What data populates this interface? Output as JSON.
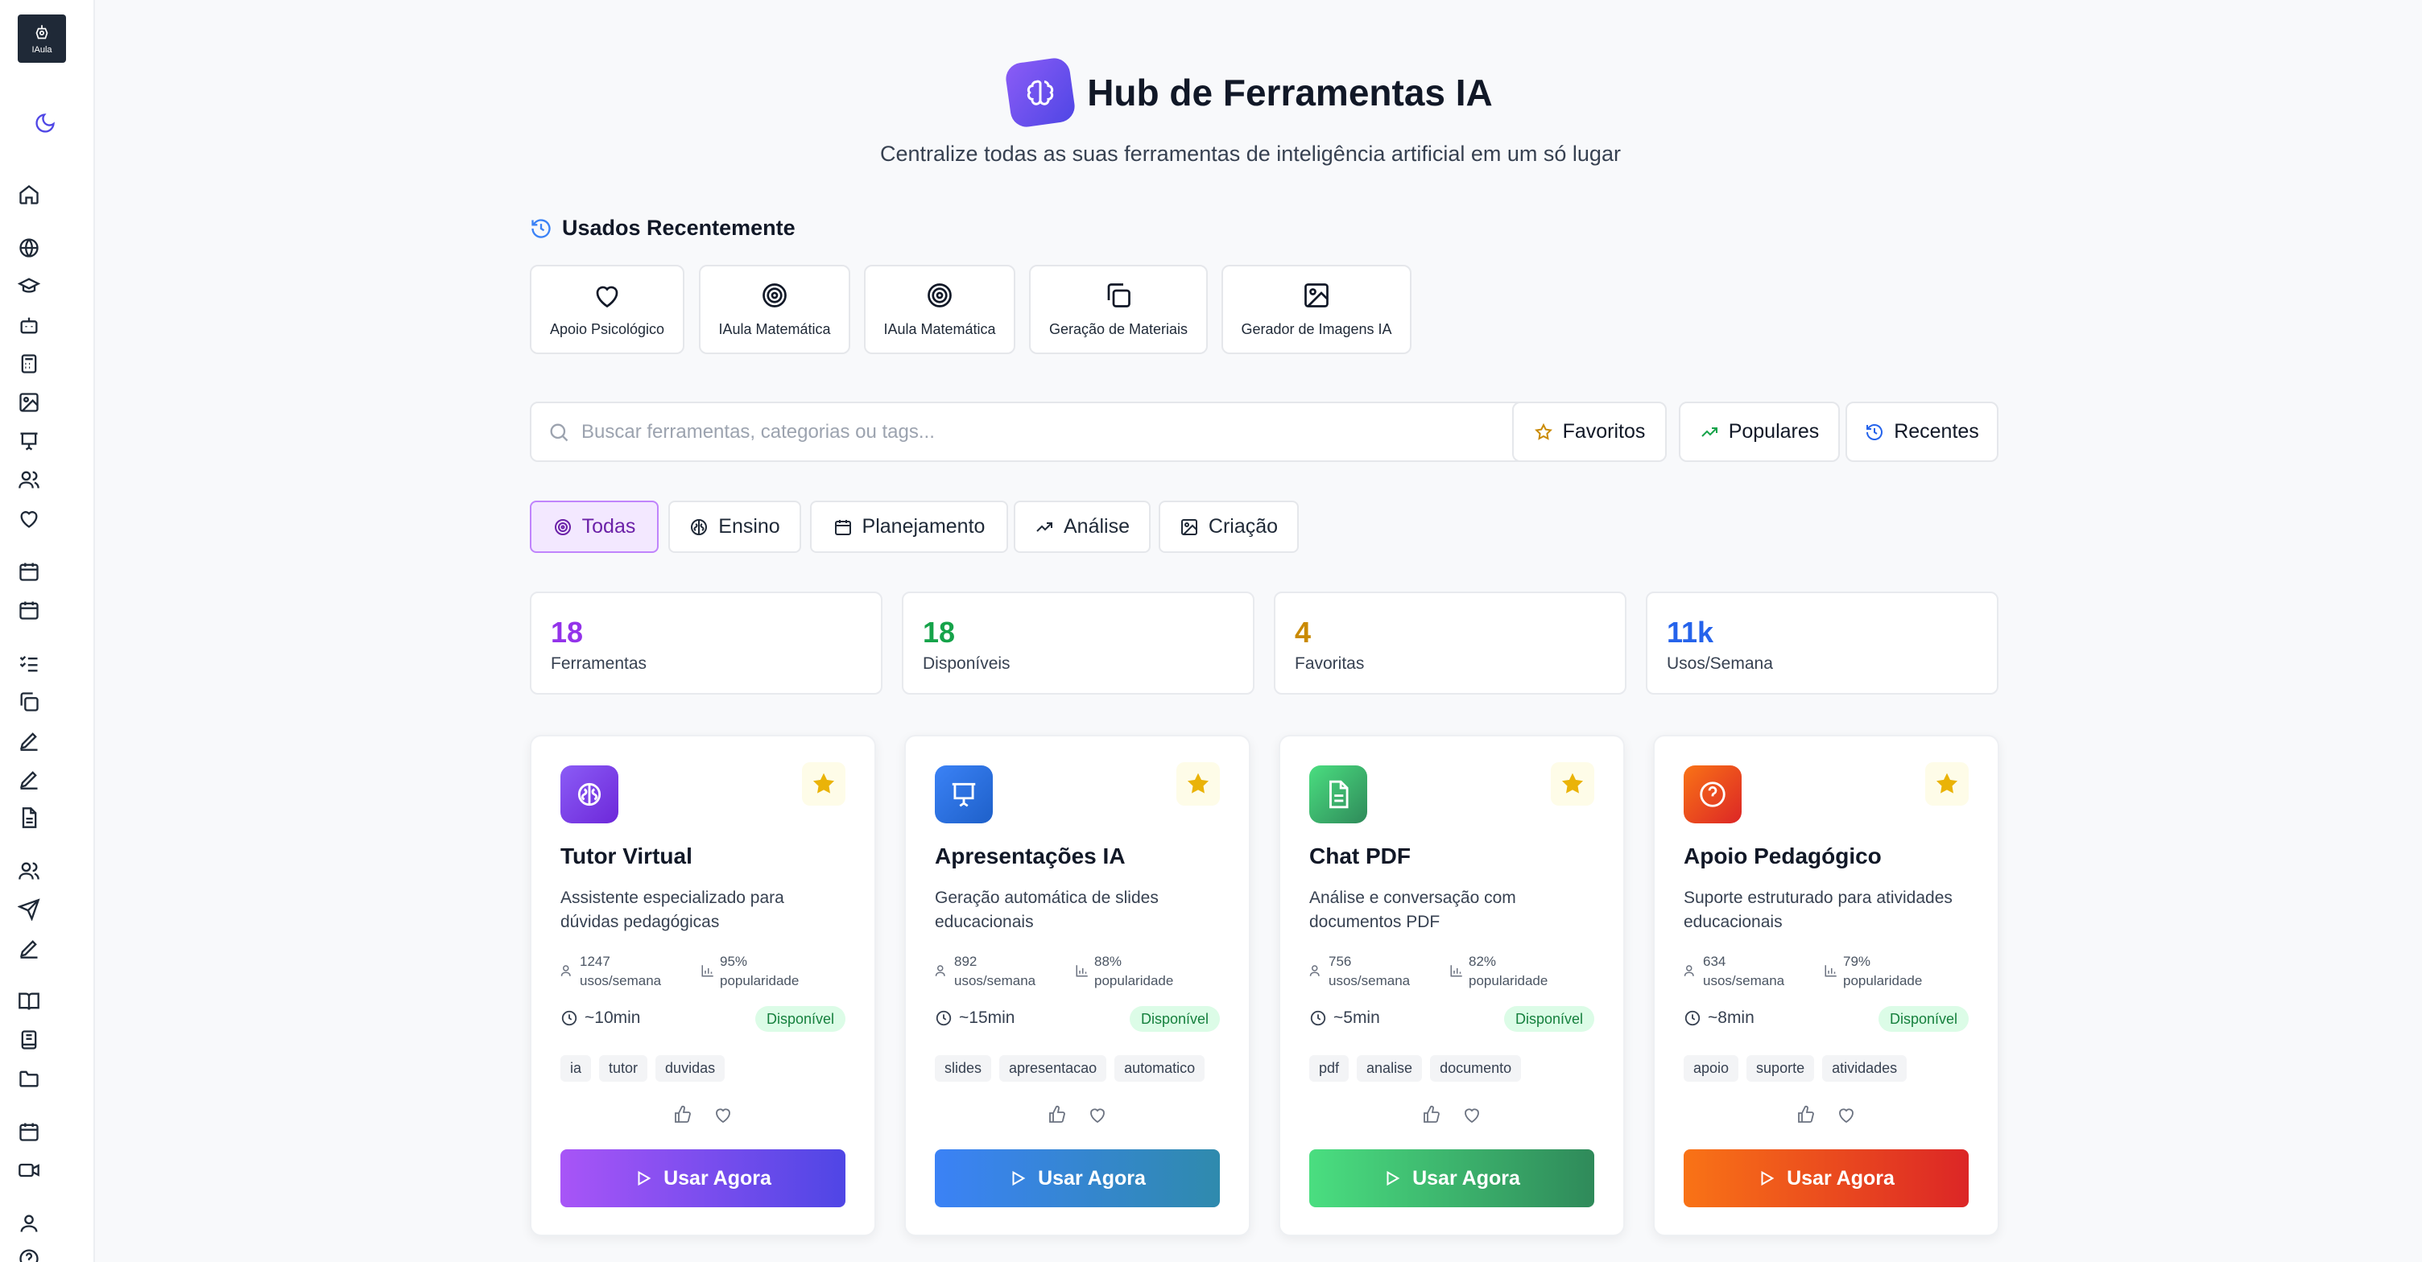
{
  "sidebar": {
    "logo_text": "IAula",
    "icons": [
      "moon-icon",
      "home-icon",
      "globe-icon",
      "graduation-cap-icon",
      "bot-icon",
      "calculator-icon",
      "image-icon",
      "presentation-icon",
      "users-icon",
      "heart-icon",
      "calendar-icon",
      "calendar-icon",
      "list-check-icon",
      "copy-icon",
      "pen-icon",
      "pen-icon",
      "file-text-icon",
      "users-icon",
      "send-icon",
      "pen-icon",
      "book-open-icon",
      "notebook-icon",
      "folder-icon",
      "calendar-icon",
      "video-icon",
      "user-icon",
      "help-icon"
    ]
  },
  "header": {
    "title": "Hub de Ferramentas IA",
    "subtitle": "Centralize todas as suas ferramentas de inteligência artificial em um só lugar"
  },
  "recent": {
    "title": "Usados Recentemente",
    "items": [
      {
        "label": "Apoio Psicológico",
        "icon": "heart-icon"
      },
      {
        "label": "IAula Matemática",
        "icon": "target-icon"
      },
      {
        "label": "IAula Matemática",
        "icon": "target-icon"
      },
      {
        "label": "Geração de Materiais",
        "icon": "copy-icon"
      },
      {
        "label": "Gerador de Imagens IA",
        "icon": "image-icon"
      }
    ]
  },
  "search": {
    "placeholder": "Buscar ferramentas, categorias ou tags...",
    "value": ""
  },
  "filters": {
    "favorites": "Favoritos",
    "popular": "Populares",
    "recent": "Recentes"
  },
  "categories": [
    "Todas",
    "Ensino",
    "Planejamento",
    "Análise",
    "Criação"
  ],
  "active_category": "Todas",
  "stats": [
    {
      "value": "18",
      "label": "Ferramentas",
      "color": "#9333ea"
    },
    {
      "value": "18",
      "label": "Disponíveis",
      "color": "#16a34a"
    },
    {
      "value": "4",
      "label": "Favoritas",
      "color": "#ca8a04"
    },
    {
      "value": "11k",
      "label": "Usos/Semana",
      "color": "#2563eb"
    }
  ],
  "tools": [
    {
      "title": "Tutor Virtual",
      "description": "Assistente especializado para dúvidas pedagógicas",
      "uses_value": "1247",
      "uses_unit": "usos/semana",
      "popularity_value": "95%",
      "popularity_unit": "popularidade",
      "duration": "~10min",
      "status": "Disponível",
      "tags": [
        "ia",
        "tutor",
        "duvidas"
      ],
      "button": "Usar Agora",
      "icon": "brain-icon"
    },
    {
      "title": "Apresentações IA",
      "description": "Geração automática de slides educacionais",
      "uses_value": "892",
      "uses_unit": "usos/semana",
      "popularity_value": "88%",
      "popularity_unit": "popularidade",
      "duration": "~15min",
      "status": "Disponível",
      "tags": [
        "slides",
        "apresentacao",
        "automatico"
      ],
      "button": "Usar Agora",
      "icon": "presentation-icon"
    },
    {
      "title": "Chat PDF",
      "description": "Análise e conversação com documentos PDF",
      "uses_value": "756",
      "uses_unit": "usos/semana",
      "popularity_value": "82%",
      "popularity_unit": "popularidade",
      "duration": "~5min",
      "status": "Disponível",
      "tags": [
        "pdf",
        "analise",
        "documento"
      ],
      "button": "Usar Agora",
      "icon": "file-text-icon"
    },
    {
      "title": "Apoio Pedagógico",
      "description": "Suporte estruturado para atividades educacionais",
      "uses_value": "634",
      "uses_unit": "usos/semana",
      "popularity_value": "79%",
      "popularity_unit": "popularidade",
      "duration": "~8min",
      "status": "Disponível",
      "tags": [
        "apoio",
        "suporte",
        "atividades"
      ],
      "button": "Usar Agora",
      "icon": "help-circle-icon"
    }
  ]
}
